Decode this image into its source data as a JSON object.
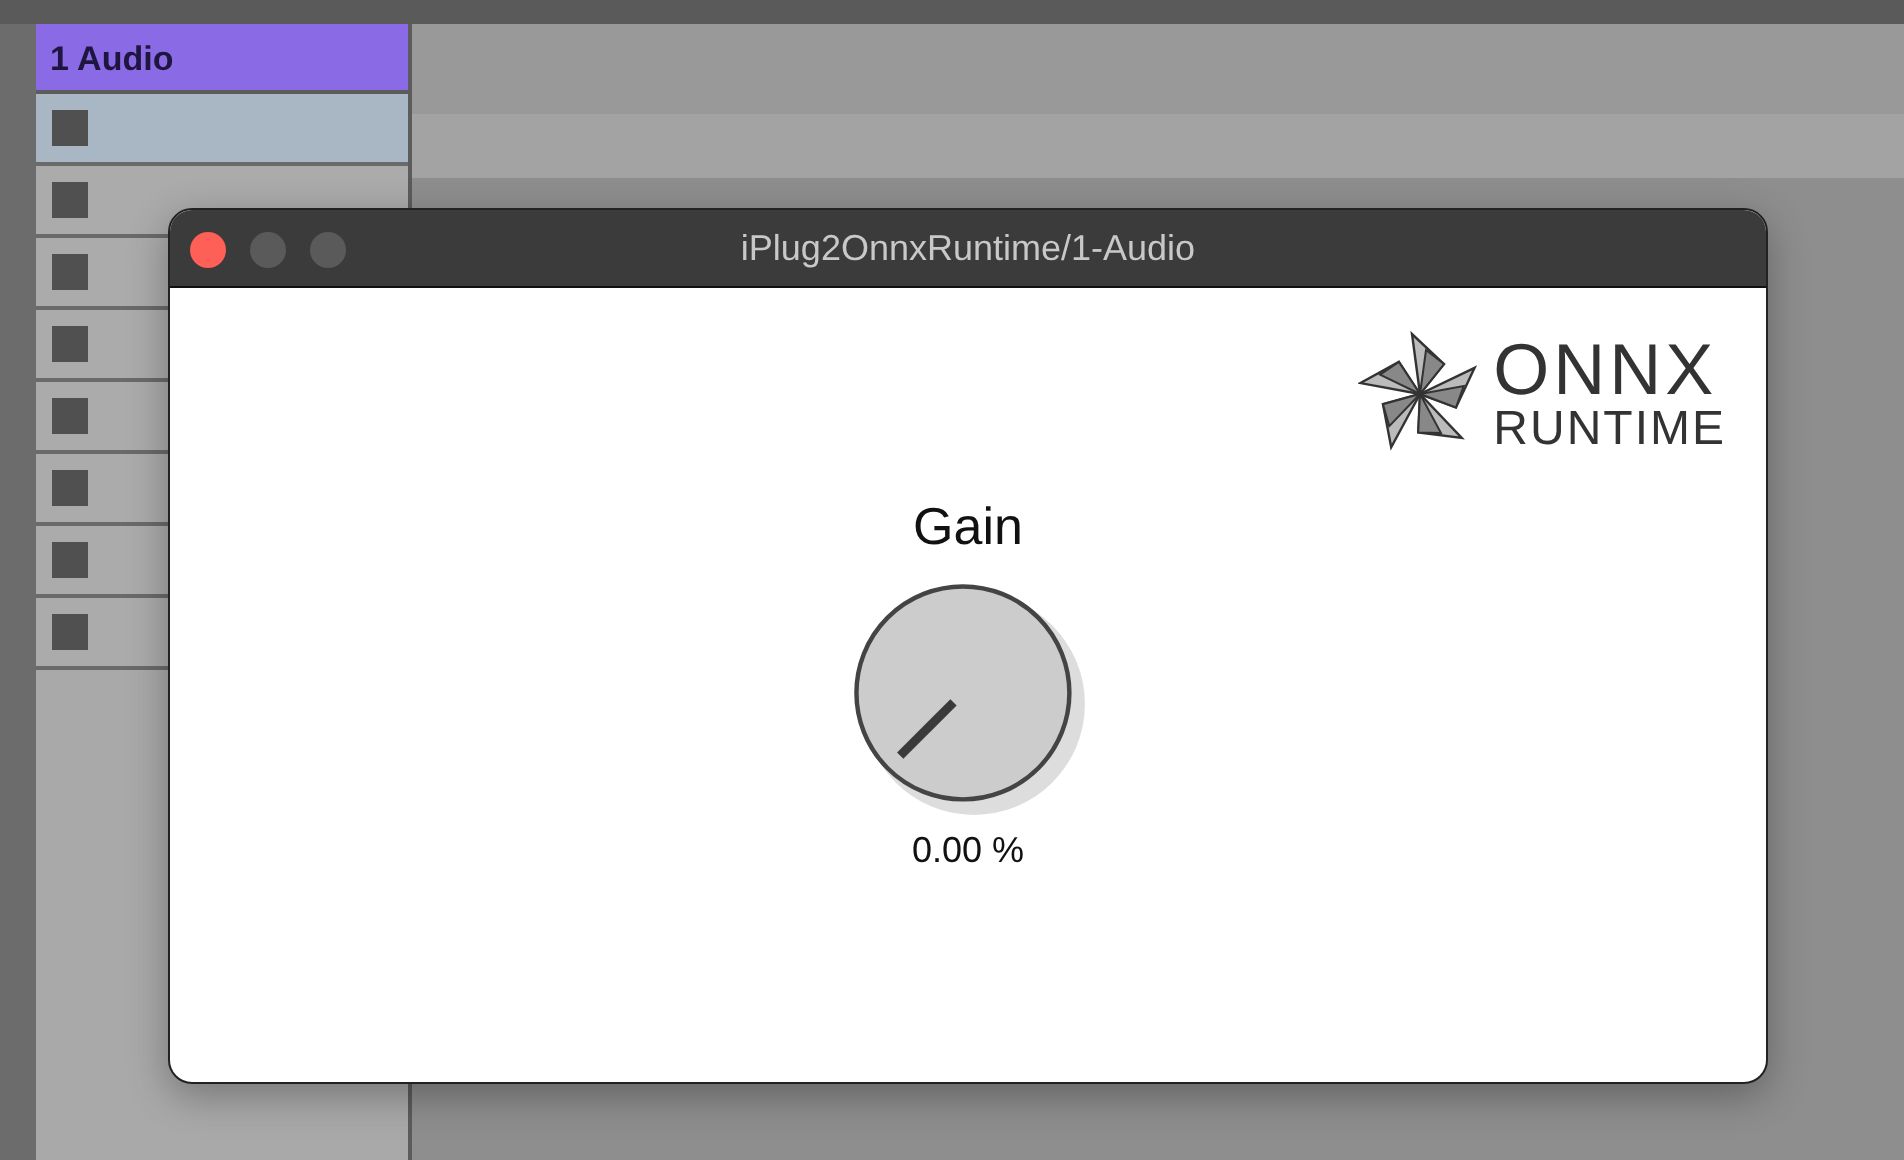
{
  "track": {
    "name": "1 Audio",
    "color": "#8b6ae6"
  },
  "slots": [
    {
      "selected": true
    },
    {
      "selected": false
    },
    {
      "selected": false
    },
    {
      "selected": false
    },
    {
      "selected": false
    },
    {
      "selected": false
    },
    {
      "selected": false
    },
    {
      "selected": false
    }
  ],
  "window": {
    "title": "iPlug2OnnxRuntime/1-Audio"
  },
  "logo": {
    "line_1": "ONNX",
    "line_2": "RUNTIME"
  },
  "knob": {
    "label": "Gain",
    "reading": "0.00 %"
  }
}
